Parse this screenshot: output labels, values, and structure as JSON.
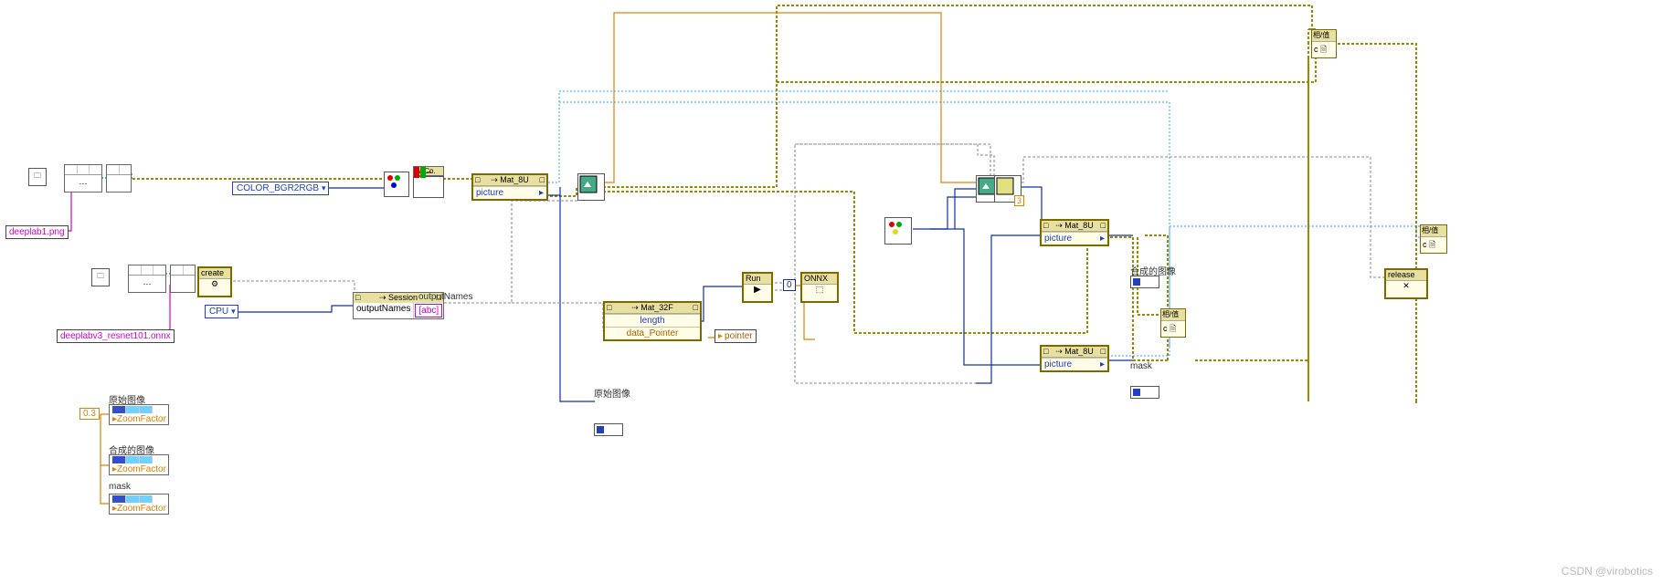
{
  "files": {
    "image_path": "deeplab1.png",
    "model_path": "deeplabv3_resnet101.onnx"
  },
  "dropdowns": {
    "color_conv": "COLOR_BGR2RGB",
    "device": "CPU"
  },
  "clusters": {
    "mat8u_1": {
      "title": "Mat_8U",
      "row": "picture",
      "hdr_l": "□",
      "hdr_r": "□"
    },
    "mat8u_2": {
      "title": "Mat_8U",
      "row": "picture",
      "hdr_l": "□",
      "hdr_r": "□"
    },
    "mat8u_3": {
      "title": "Mat_8U",
      "row": "picture",
      "hdr_l": "□",
      "hdr_r": "□"
    },
    "mat32f": {
      "title": "Mat_32F",
      "row1": "length",
      "row2": "data_Pointer",
      "out": "pointer",
      "hdr_l": "□",
      "hdr_r": "□"
    }
  },
  "session": {
    "title": "Session",
    "label": "outputNames",
    "field": "outputNames",
    "tag": "abc"
  },
  "numeric": {
    "zero_three": "0.3",
    "zero": "0",
    "three": "3"
  },
  "indicators": {
    "orig": "原始图像",
    "comp": "合成的图像",
    "mask": "mask",
    "zoom": "ZoomFactor"
  },
  "labels": {
    "orig_group": "原始图像",
    "comp_group": "合成的图像",
    "mask_group": "mask",
    "cvtCol": "cvtCo.",
    "create": "create",
    "run": "Run",
    "onnx": "ONNX",
    "close": "相/值",
    "release": "release",
    "c_doc": "c 🗎"
  },
  "watermark": "CSDN @virobotics"
}
